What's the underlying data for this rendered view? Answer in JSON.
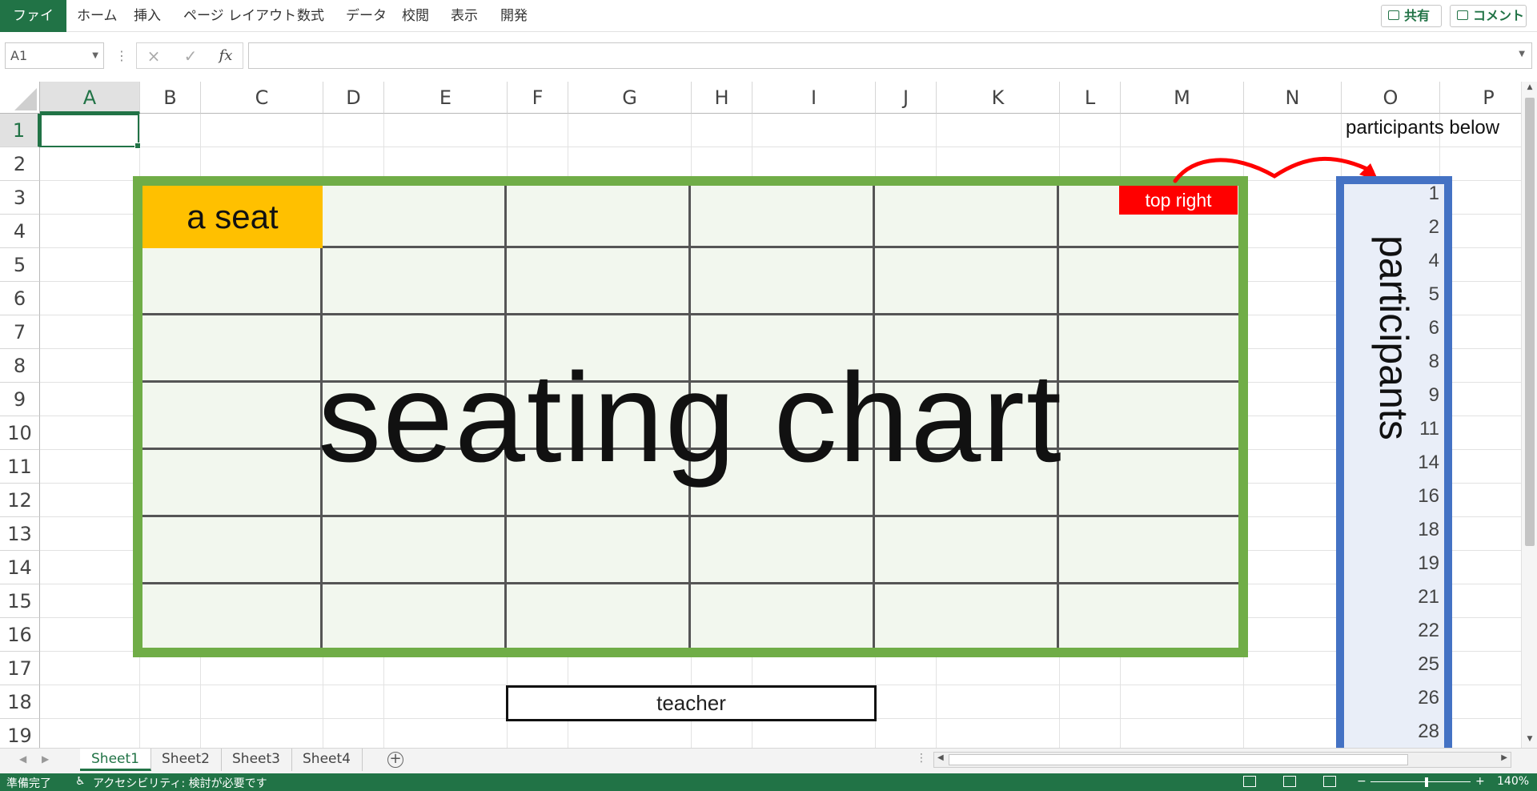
{
  "ribbon": {
    "tabs": [
      "ファイル",
      "ホーム",
      "挿入",
      "ページ レイアウト",
      "数式",
      "データ",
      "校閲",
      "表示",
      "開発"
    ],
    "share_label": "共有",
    "comment_label": "コメント"
  },
  "formula_bar": {
    "name_box": "A1",
    "cancel_icon": "×",
    "enter_icon": "✓",
    "fx_label": "fx",
    "value": ""
  },
  "columns": [
    "A",
    "B",
    "C",
    "D",
    "E",
    "F",
    "G",
    "H",
    "I",
    "J",
    "K",
    "L",
    "M",
    "N",
    "O",
    "P"
  ],
  "rows": [
    "1",
    "2",
    "3",
    "4",
    "5",
    "6",
    "7",
    "8",
    "9",
    "10",
    "11",
    "12",
    "13",
    "14",
    "15",
    "16",
    "17",
    "18",
    "19"
  ],
  "selected_cell": "A1",
  "shapes": {
    "a_seat": "a seat",
    "top_right": "top right",
    "chart_title": "seating chart",
    "teacher": "teacher",
    "participants_note": "participants below",
    "participants_title": "participants",
    "participant_numbers": [
      "1",
      "2",
      "4",
      "5",
      "6",
      "8",
      "9",
      "11",
      "14",
      "16",
      "18",
      "19",
      "21",
      "22",
      "25",
      "26",
      "28"
    ],
    "colors": {
      "chart_border": "#70ad47",
      "chart_fill": "#f2f7ee",
      "seat_fill": "#ffc000",
      "top_right_fill": "#ff0000",
      "participants_border": "#4472c4",
      "arrow": "#ff0000"
    }
  },
  "sheet_tabs": [
    "Sheet1",
    "Sheet2",
    "Sheet3",
    "Sheet4"
  ],
  "active_sheet": "Sheet1",
  "status": {
    "ready": "準備完了",
    "accessibility": "アクセシビリティ: 検討が必要です",
    "zoom": "140%"
  }
}
